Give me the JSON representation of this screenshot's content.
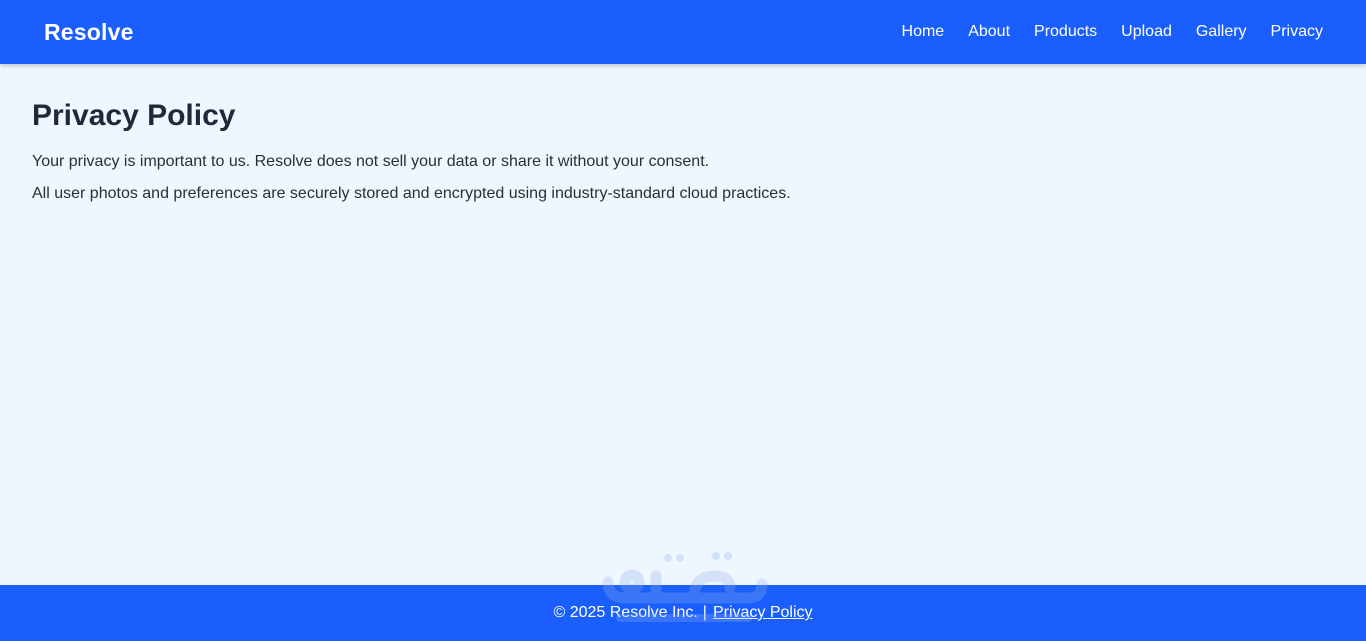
{
  "header": {
    "brand": "Resolve",
    "nav": [
      "Home",
      "About",
      "Products",
      "Upload",
      "Gallery",
      "Privacy"
    ]
  },
  "main": {
    "title": "Privacy Policy",
    "paragraphs": [
      "Your privacy is important to us. Resolve does not sell your data or share it without your consent.",
      "All user photos and preferences are securely stored and encrypted using industry-standard cloud practices."
    ]
  },
  "footer": {
    "copyright": "© 2025 Resolve Inc.",
    "separator": "|",
    "link": "Privacy Policy"
  },
  "colors": {
    "primary": "#1a5ffe",
    "background": "#eef6ff",
    "text": "#1f2937"
  }
}
